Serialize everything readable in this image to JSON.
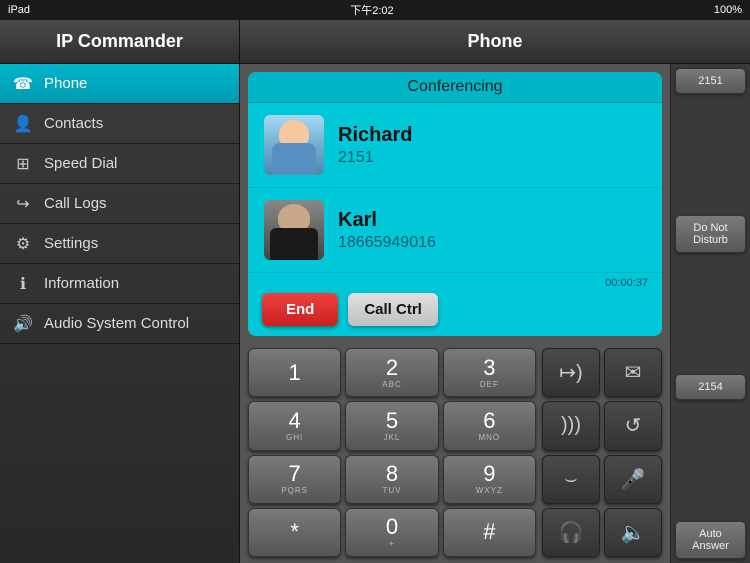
{
  "statusBar": {
    "device": "iPad",
    "time": "下午2:02",
    "battery": "100%",
    "batteryIcon": "battery-icon",
    "wifiIcon": "wifi-icon",
    "bluetoothIcon": "bluetooth-icon"
  },
  "header": {
    "appTitle": "IP Commander",
    "sectionTitle": "Phone"
  },
  "sidebar": {
    "items": [
      {
        "id": "phone",
        "label": "Phone",
        "icon": "☎",
        "active": true
      },
      {
        "id": "contacts",
        "label": "Contacts",
        "icon": "👤",
        "active": false
      },
      {
        "id": "speed-dial",
        "label": "Speed Dial",
        "icon": "⊞",
        "active": false
      },
      {
        "id": "call-logs",
        "label": "Call Logs",
        "icon": "↪",
        "active": false
      },
      {
        "id": "settings",
        "label": "Settings",
        "icon": "⚙",
        "active": false
      },
      {
        "id": "information",
        "label": "Information",
        "icon": "ℹ",
        "active": false
      },
      {
        "id": "audio-system-control",
        "label": "Audio System Control",
        "icon": "🔊",
        "active": false
      }
    ]
  },
  "conferencing": {
    "title": "Conferencing",
    "callers": [
      {
        "name": "Richard",
        "number": "2151",
        "avatarType": "richard"
      },
      {
        "name": "Karl",
        "number": "18665949016",
        "avatarType": "karl"
      }
    ],
    "timer": "00:00:37",
    "endButton": "End",
    "callCtrlButton": "Call Ctrl"
  },
  "dialpad": {
    "keys": [
      {
        "main": "1",
        "sub": ""
      },
      {
        "main": "2",
        "sub": "ABC"
      },
      {
        "main": "3",
        "sub": "DEF"
      },
      {
        "main": "4",
        "sub": "GHI"
      },
      {
        "main": "5",
        "sub": "JKL"
      },
      {
        "main": "6",
        "sub": "MNO"
      },
      {
        "main": "7",
        "sub": "PQRS"
      },
      {
        "main": "8",
        "sub": "TUV"
      },
      {
        "main": "9",
        "sub": "WXYZ"
      },
      {
        "main": "*",
        "sub": ""
      },
      {
        "main": "0",
        "sub": "+"
      },
      {
        "main": "#",
        "sub": ""
      }
    ]
  },
  "actionButtons": [
    {
      "icon": "↦)",
      "label": "transfer"
    },
    {
      "icon": "✉",
      "label": "message"
    },
    {
      "icon": ")))",
      "label": "speaker"
    },
    {
      "icon": "↺",
      "label": "refresh"
    },
    {
      "icon": "⌣",
      "label": "hold"
    },
    {
      "icon": "🎤",
      "label": "mute"
    },
    {
      "icon": "🎧",
      "label": "headset"
    },
    {
      "icon": "🔈",
      "label": "volume"
    }
  ],
  "rightSidebar": {
    "buttons": [
      {
        "label": "2151"
      },
      {
        "label": "Do Not Disturb"
      },
      {
        "label": "2154"
      },
      {
        "label": "Auto Answer"
      }
    ]
  }
}
